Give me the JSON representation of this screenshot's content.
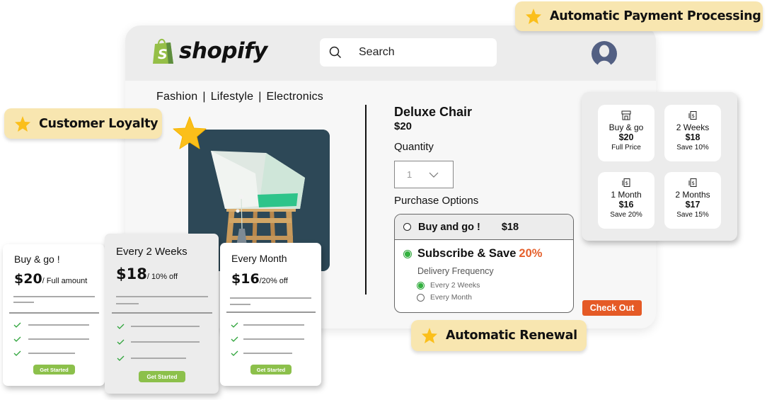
{
  "header": {
    "brand": "shopify",
    "search_placeholder": "Search"
  },
  "categories": [
    "Fashion",
    "Lifestyle",
    "Electronics"
  ],
  "product": {
    "title": "Deluxe Chair",
    "price": "$20",
    "quantity_label": "Quantity",
    "quantity_value": "1",
    "purchase_options_label": "Purchase Options"
  },
  "purchase_options": {
    "one_time": {
      "label": "Buy and go !",
      "price": "$18",
      "selected": false
    },
    "subscribe": {
      "label": "Subscribe & Save",
      "discount": "20%",
      "selected": true
    },
    "delivery_frequency_label": "Delivery Frequency",
    "frequencies": [
      {
        "label": "Every 2 Weeks",
        "selected": true
      },
      {
        "label": "Every Month",
        "selected": false
      }
    ]
  },
  "checkout_label": "Check Out",
  "plan_grid": [
    {
      "icon": "storefront-icon",
      "name": "Buy & go",
      "price": "$20",
      "note": "Full Price"
    },
    {
      "icon": "recurring-payment-icon",
      "name": "2 Weeks",
      "price": "$18",
      "note": "Save 10%"
    },
    {
      "icon": "recurring-payment-icon",
      "name": "1 Month",
      "price": "$16",
      "note": "Save 20%"
    },
    {
      "icon": "recurring-payment-icon",
      "name": "2 Months",
      "price": "$17",
      "note": "Save 15%"
    }
  ],
  "badges": {
    "payment": "Automatic Payment Processing",
    "loyalty": "Customer Loyalty",
    "renewal": "Automatic Renewal"
  },
  "pricing_cards": [
    {
      "title": "Buy & go !",
      "price": "$20",
      "suffix": "/ Full amount",
      "cta": "Get Started"
    },
    {
      "title": "Every 2 Weeks",
      "price": "$18",
      "suffix": "/ 10% off",
      "cta": "Get Started"
    },
    {
      "title": "Every Month",
      "price": "$16",
      "suffix": "/20% off",
      "cta": "Get Started"
    }
  ],
  "colors": {
    "accent_orange": "#e55a26",
    "badge_bg": "#f8e6b0",
    "star": "#fbbf1a",
    "radio_green": "#33b13f",
    "cta_green": "#8cc04b",
    "shopify_green": "#7ab55c"
  }
}
